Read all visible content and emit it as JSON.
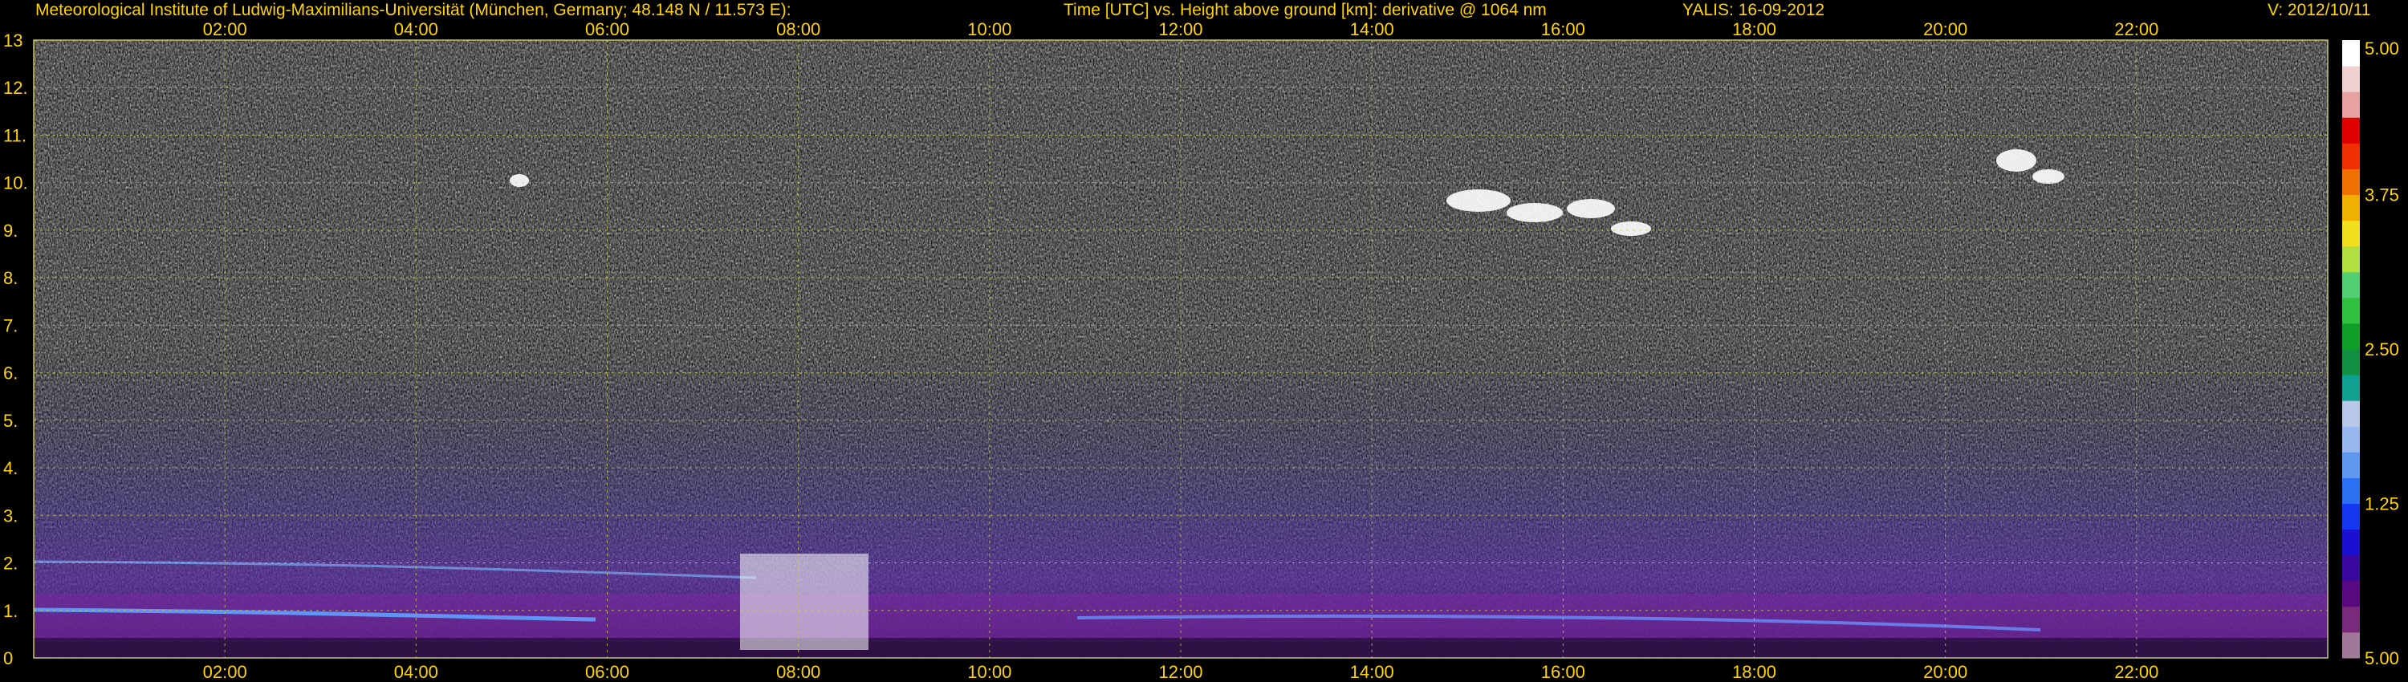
{
  "header": {
    "institute": "Meteorological Institute of Ludwig-Maximilians-Universität (München, Germany; 48.148 N / 11.573 E):",
    "description": "Time [UTC] vs. Height above ground [km]: derivative @ 1064 nm",
    "instrument_date": "YALIS: 16-09-2012",
    "version": "V: 2012/10/11"
  },
  "colors": {
    "text": "#ffd400",
    "grid": "#c8c864",
    "background": "#000000",
    "colorbar": [
      "#a07898",
      "#7a2a7a",
      "#5a0a80",
      "#3a0aa0",
      "#1a10d0",
      "#1438f0",
      "#2a70f0",
      "#6098f0",
      "#98b8f0",
      "#b8c8e8",
      "#10a090",
      "#109040",
      "#10a028",
      "#30c040",
      "#50d070",
      "#b0e040",
      "#f0e020",
      "#f0b000",
      "#f07000",
      "#f03000",
      "#e00000",
      "#e8a0a0",
      "#f0d0d0",
      "#ffffff"
    ]
  },
  "chart_data": {
    "type": "heatmap",
    "title": "Time [UTC] vs. Height above ground [km]: derivative @ 1064 nm",
    "x_ticks": [
      "02:00",
      "04:00",
      "06:00",
      "08:00",
      "10:00",
      "12:00",
      "14:00",
      "16:00",
      "18:00",
      "20:00",
      "22:00"
    ],
    "x_tick_hours": [
      2,
      4,
      6,
      8,
      10,
      12,
      14,
      16,
      18,
      20,
      22
    ],
    "x_range": [
      0,
      24
    ],
    "y_ticks": [
      "0",
      "1.",
      "2.",
      "3.",
      "4.",
      "5.",
      "6.",
      "7.",
      "8.",
      "9.",
      "10.",
      "11.",
      "12.",
      "13"
    ],
    "y_range": [
      0,
      13
    ],
    "y_unit": "km",
    "grid": true,
    "colorbar": {
      "ticks": [
        "5.00",
        "3.75",
        "2.50",
        "1.25",
        "5.00"
      ],
      "tick_positions": [
        1.0,
        0.75,
        0.5,
        0.25,
        0.0
      ]
    }
  }
}
